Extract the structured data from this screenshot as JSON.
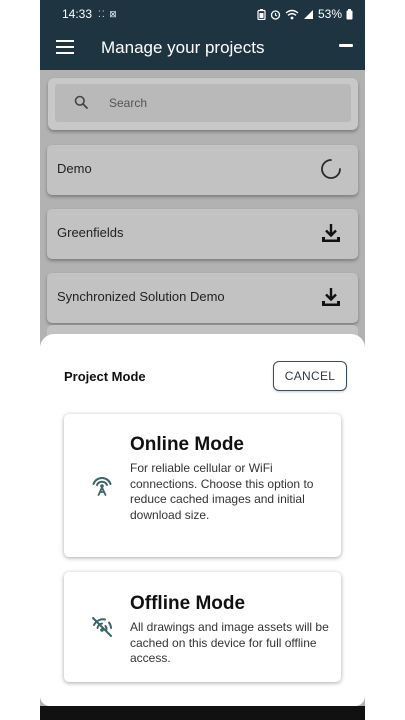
{
  "status_bar": {
    "time": "14:33",
    "battery": "53%"
  },
  "app_bar": {
    "title": "Manage your projects"
  },
  "search": {
    "placeholder": "Search"
  },
  "projects": [
    {
      "name": "Demo",
      "status_icon": "loading-spinner-icon"
    },
    {
      "name": "Greenfields",
      "status_icon": "download-icon"
    },
    {
      "name": "Synchronized Solution Demo",
      "status_icon": "download-icon"
    }
  ],
  "sheet": {
    "title": "Project Mode",
    "cancel_label": "CANCEL",
    "modes": [
      {
        "title": "Online Mode",
        "description": "For reliable cellular or WiFi connections. Choose this option to reduce cached images and initial download size.",
        "icon": "antenna-signal-icon"
      },
      {
        "title": "Offline Mode",
        "description": "All drawings and image assets will be cached on this device for full offline access.",
        "icon": "signal-off-icon"
      }
    ]
  },
  "colors": {
    "app_bar": "#1f3441",
    "scrim_background": "#b2b2b2",
    "icon_teal": "#3d6468"
  }
}
